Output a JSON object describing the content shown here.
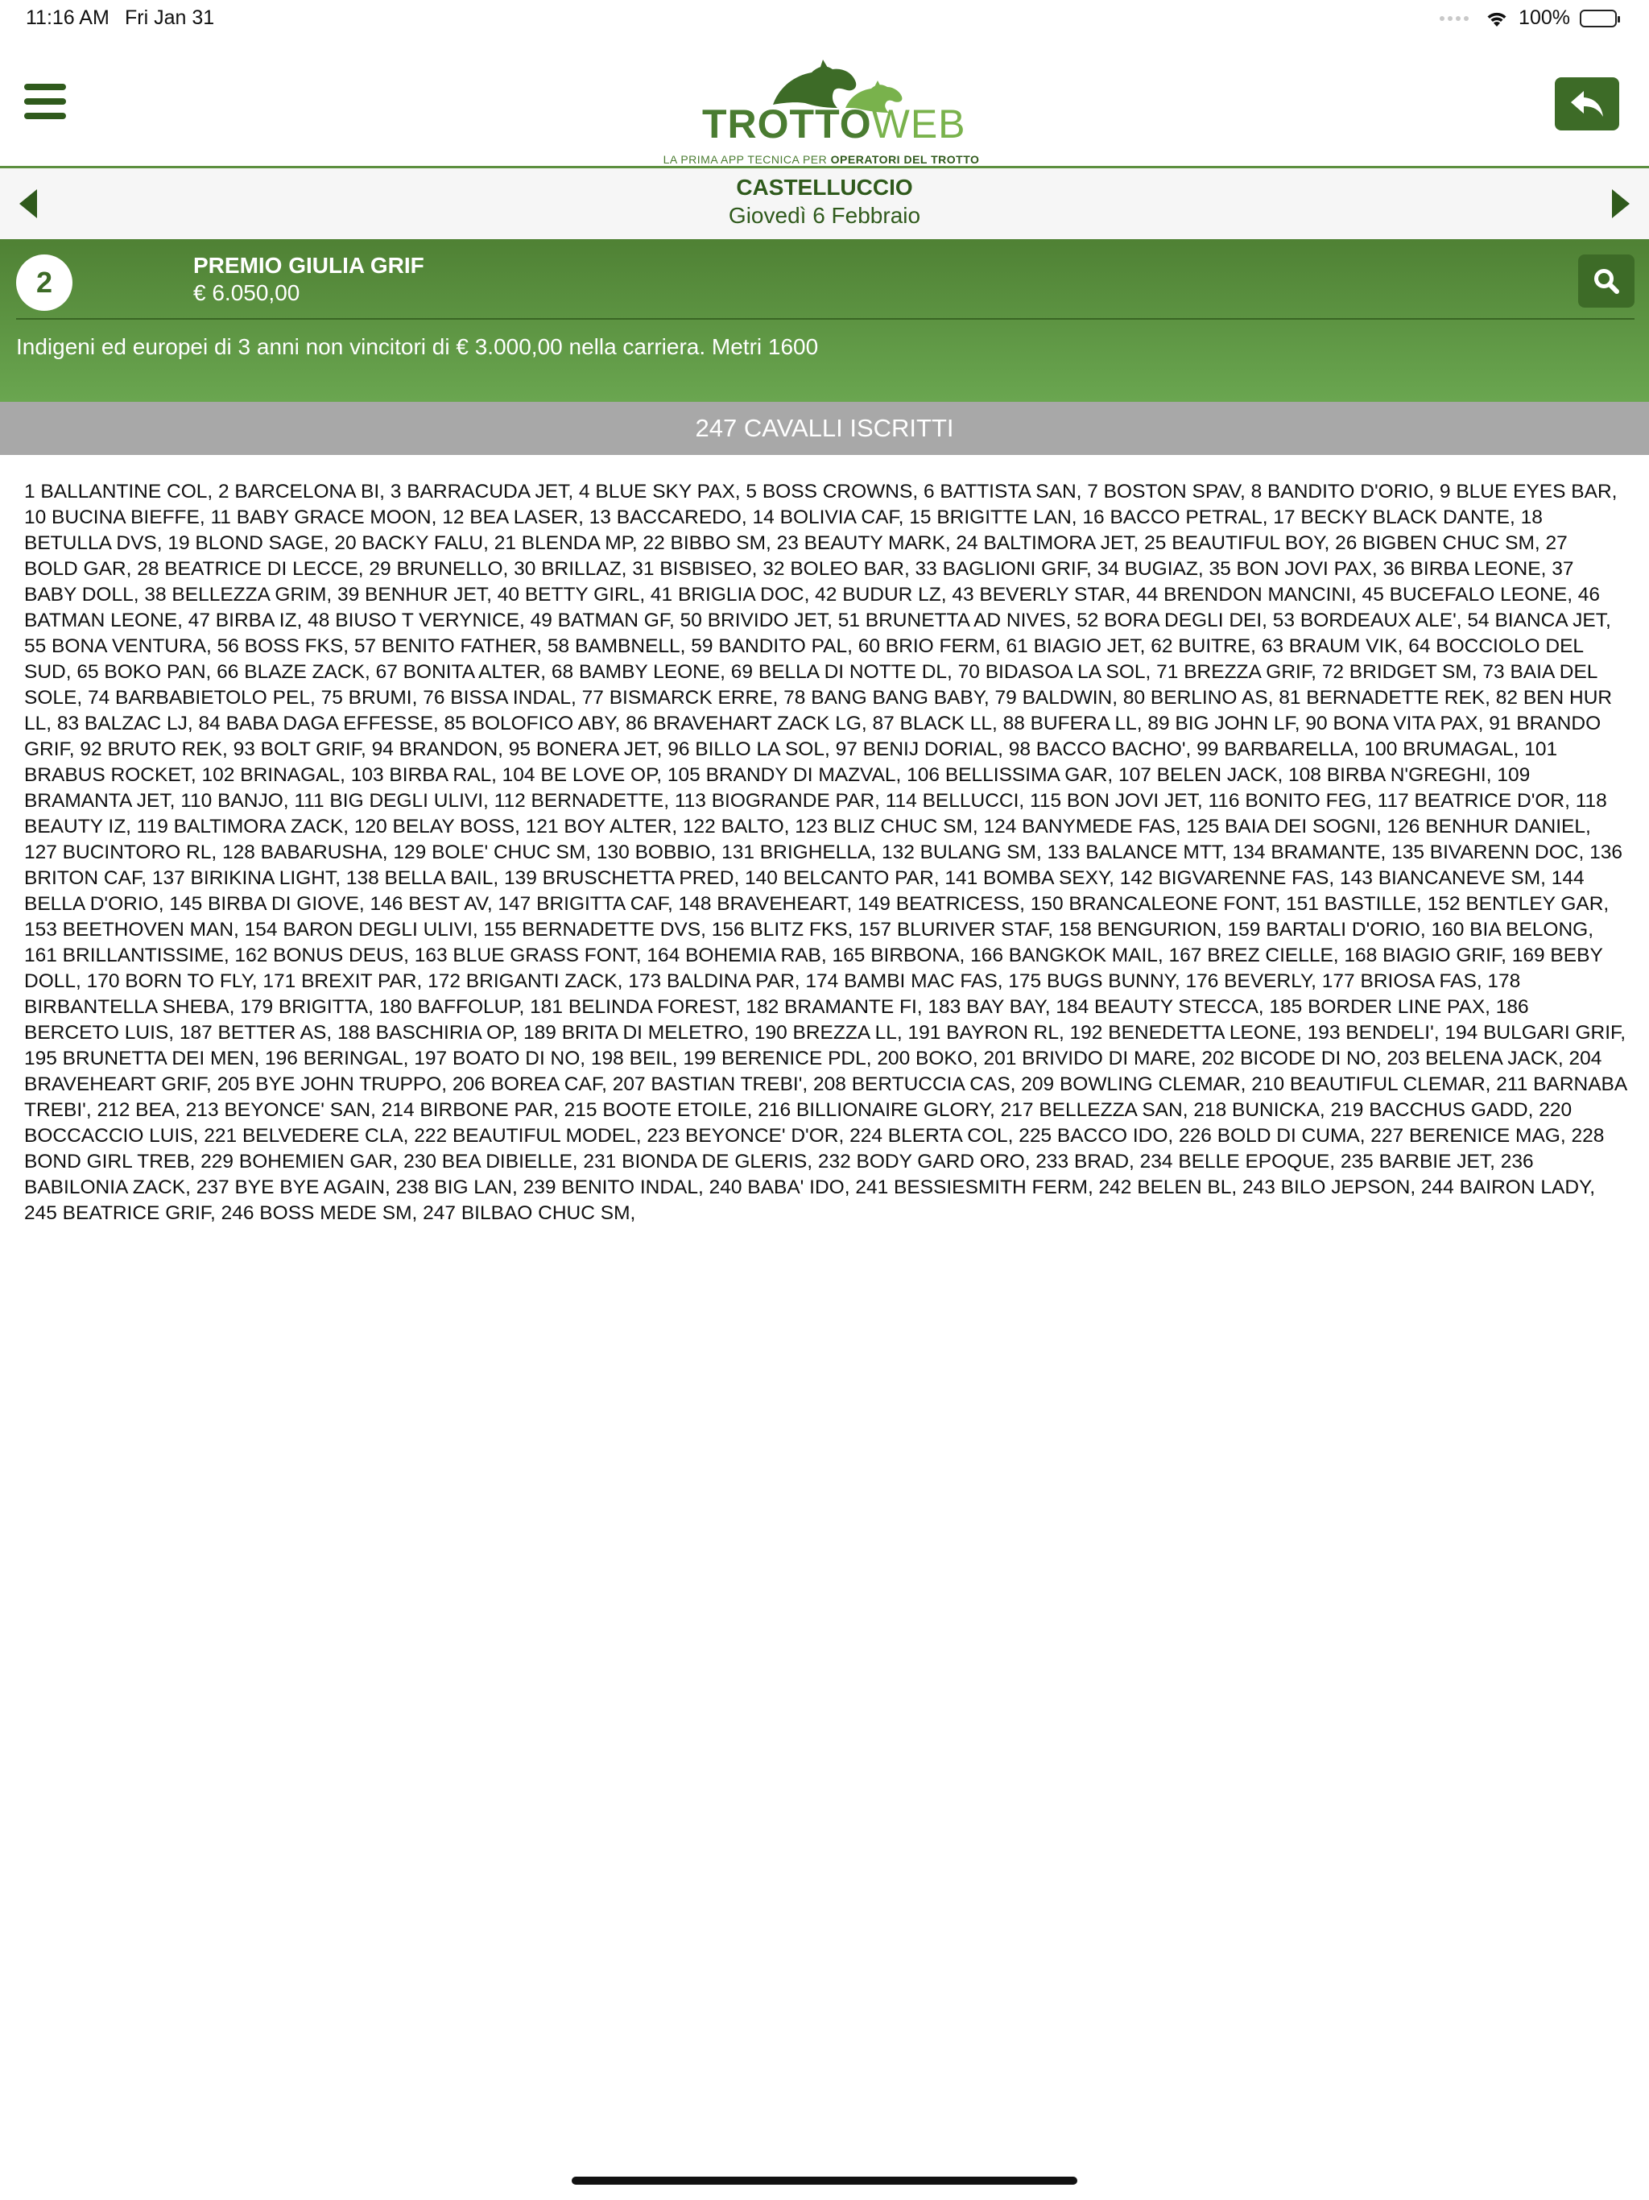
{
  "status_bar": {
    "time": "11:16 AM",
    "date": "Fri Jan 31",
    "battery": "100%"
  },
  "header": {
    "logo_trotto": "TROTTO",
    "logo_web": "WEB",
    "logo_subtitle_prefix": "LA PRIMA APP TECNICA PER ",
    "logo_subtitle_bold": "OPERATORI DEL TROTTO",
    "icons": {
      "menu": "hamburger-menu-icon",
      "back": "reply-arrow-icon"
    }
  },
  "nav": {
    "venue": "CASTELLUCCIO",
    "date": "Giovedì 6 Febbraio"
  },
  "race": {
    "number": "2",
    "name": "PREMIO GIULIA GRIF",
    "prize": "€ 6.050,00",
    "description": "Indigeni ed europei di 3 anni non vincitori di € 3.000,00 nella carriera. Metri 1600"
  },
  "entries": {
    "header": "247 CAVALLI ISCRITTI",
    "list": "1 BALLANTINE COL, 2 BARCELONA BI, 3 BARRACUDA JET, 4 BLUE SKY PAX, 5 BOSS CROWNS, 6 BATTISTA SAN, 7 BOSTON SPAV, 8 BANDITO D'ORIO, 9 BLUE EYES BAR, 10 BUCINA BIEFFE, 11 BABY GRACE MOON, 12 BEA LASER, 13 BACCAREDO, 14 BOLIVIA CAF, 15 BRIGITTE LAN, 16 BACCO PETRAL, 17 BECKY BLACK DANTE, 18 BETULLA DVS, 19 BLOND SAGE, 20 BACKY FALU, 21 BLENDA MP, 22 BIBBO SM, 23 BEAUTY MARK, 24 BALTIMORA JET, 25 BEAUTIFUL BOY, 26 BIGBEN CHUC SM, 27 BOLD GAR, 28 BEATRICE DI LECCE, 29 BRUNELLO, 30 BRILLAZ, 31 BISBISEO, 32 BOLEO BAR, 33 BAGLIONI GRIF, 34 BUGIAZ, 35 BON JOVI PAX, 36 BIRBA LEONE, 37 BABY DOLL, 38 BELLEZZA GRIM, 39 BENHUR JET, 40 BETTY GIRL, 41 BRIGLIA DOC, 42 BUDUR LZ, 43 BEVERLY STAR, 44 BRENDON MANCINI, 45 BUCEFALO LEONE, 46 BATMAN LEONE, 47 BIRBA IZ, 48 BIUSO T VERYNICE, 49 BATMAN GF, 50 BRIVIDO JET, 51 BRUNETTA AD NIVES, 52 BORA DEGLI DEI, 53 BORDEAUX ALE', 54 BIANCA JET, 55 BONA VENTURA, 56 BOSS FKS, 57 BENITO FATHER, 58 BAMBNELL, 59 BANDITO PAL, 60 BRIO FERM, 61 BIAGIO JET, 62 BUITRE, 63 BRAUM VIK, 64 BOCCIOLO DEL SUD, 65 BOKO PAN, 66 BLAZE ZACK, 67 BONITA ALTER, 68 BAMBY LEONE, 69 BELLA DI NOTTE DL, 70 BIDASOA LA SOL, 71 BREZZA GRIF, 72 BRIDGET SM, 73 BAIA DEL SOLE, 74 BARBABIETOLO PEL, 75 BRUMI, 76 BISSA INDAL, 77 BISMARCK ERRE, 78 BANG BANG BABY, 79 BALDWIN, 80 BERLINO AS, 81 BERNADETTE REK, 82 BEN HUR LL, 83 BALZAC LJ, 84 BABA DAGA EFFESSE, 85 BOLOFICO ABY, 86 BRAVEHART ZACK LG, 87 BLACK LL, 88 BUFERA LL, 89 BIG JOHN LF, 90 BONA VITA PAX, 91 BRANDO GRIF, 92 BRUTO REK, 93 BOLT GRIF, 94 BRANDON, 95 BONERA JET, 96 BILLO LA SOL, 97 BENIJ DORIAL, 98 BACCO BACHO', 99 BARBARELLA, 100 BRUMAGAL, 101 BRABUS ROCKET, 102 BRINAGAL, 103 BIRBA RAL, 104 BE LOVE OP, 105 BRANDY DI MAZVAL, 106 BELLISSIMA GAR, 107 BELEN JACK, 108 BIRBA N'GREGHI, 109 BRAMANTA JET, 110 BANJO, 111 BIG DEGLI ULIVI, 112 BERNADETTE, 113 BIOGRANDE PAR, 114 BELLUCCI, 115 BON JOVI JET, 116 BONITO FEG, 117 BEATRICE D'OR, 118 BEAUTY IZ, 119 BALTIMORA ZACK, 120 BELAY BOSS, 121 BOY ALTER, 122 BALTO, 123 BLIZ CHUC SM, 124 BANYMEDE FAS, 125 BAIA DEI SOGNI, 126 BENHUR DANIEL, 127 BUCINTORO RL, 128 BABARUSHA, 129 BOLE' CHUC SM, 130 BOBBIO, 131 BRIGHELLA, 132 BULANG SM, 133 BALANCE MTT, 134 BRAMANTE, 135 BIVARENN DOC, 136 BRITON CAF, 137 BIRIKINA LIGHT, 138 BELLA BAIL, 139 BRUSCHETTA PRED, 140 BELCANTO PAR, 141 BOMBA SEXY, 142 BIGVARENNE FAS, 143 BIANCANEVE SM, 144 BELLA D'ORIO, 145 BIRBA DI GIOVE, 146 BEST AV, 147 BRIGITTA CAF, 148 BRAVEHEART, 149 BEATRICESS, 150 BRANCALEONE FONT, 151 BASTILLE, 152 BENTLEY GAR, 153 BEETHOVEN MAN, 154 BARON DEGLI ULIVI, 155 BERNADETTE DVS, 156 BLITZ FKS, 157 BLURIVER STAF, 158 BENGURION, 159 BARTALI D'ORIO, 160 BIA BELONG, 161 BRILLANTISSIME, 162 BONUS DEUS, 163 BLUE GRASS FONT, 164 BOHEMIA RAB, 165 BIRBONA, 166 BANGKOK MAIL, 167 BREZ CIELLE, 168 BIAGIO GRIF, 169 BEBY DOLL, 170 BORN TO FLY, 171 BREXIT PAR, 172 BRIGANTI ZACK, 173 BALDINA PAR, 174 BAMBI MAC FAS, 175 BUGS BUNNY, 176 BEVERLY, 177 BRIOSA FAS, 178 BIRBANTELLA SHEBA, 179 BRIGITTA, 180 BAFFOLUP, 181 BELINDA FOREST, 182 BRAMANTE FI, 183 BAY BAY, 184 BEAUTY STECCA, 185 BORDER LINE PAX, 186 BERCETO LUIS, 187 BETTER AS, 188 BASCHIRIA OP, 189 BRITA DI MELETRO, 190 BREZZA LL, 191 BAYRON RL, 192 BENEDETTA LEONE, 193 BENDELI', 194 BULGARI GRIF, 195 BRUNETTA DEI MEN, 196 BERINGAL, 197 BOATO DI NO, 198 BEIL, 199 BERENICE PDL, 200 BOKO, 201 BRIVIDO DI MARE, 202 BICODE DI NO, 203 BELENA JACK, 204 BRAVEHEART GRIF, 205 BYE JOHN TRUPPO, 206 BOREA CAF, 207 BASTIAN TREBI', 208 BERTUCCIA CAS, 209 BOWLING CLEMAR, 210 BEAUTIFUL CLEMAR, 211 BARNABA TREBI', 212 BEA, 213 BEYONCE' SAN, 214 BIRBONE PAR, 215 BOOTE ETOILE, 216 BILLIONAIRE GLORY, 217 BELLEZZA SAN, 218 BUNICKA, 219 BACCHUS GADD, 220 BOCCACCIO LUIS, 221 BELVEDERE CLA, 222 BEAUTIFUL MODEL, 223 BEYONCE' D'OR, 224 BLERTA COL, 225 BACCO IDO, 226 BOLD DI CUMA, 227 BERENICE MAG, 228 BOND GIRL TREB, 229 BOHEMIEN GAR, 230 BEA DIBIELLE, 231 BIONDA DE GLERIS, 232 BODY GARD ORO, 233 BRAD, 234 BELLE EPOQUE, 235 BARBIE JET, 236 BABILONIA ZACK, 237 BYE BYE AGAIN, 238 BIG LAN, 239 BENITO INDAL, 240 BABA' IDO, 241 BESSIESMITH FERM, 242 BELEN BL, 243 BILO JEPSON, 244 BAIRON LADY, 245 BEATRICE GRIF, 246 BOSS MEDE SM, 247 BILBAO CHUC SM,"
  },
  "colors": {
    "brand_dark": "#3d6b27",
    "brand_light": "#6aa650",
    "entries_header_bg": "#a8a8a8"
  }
}
